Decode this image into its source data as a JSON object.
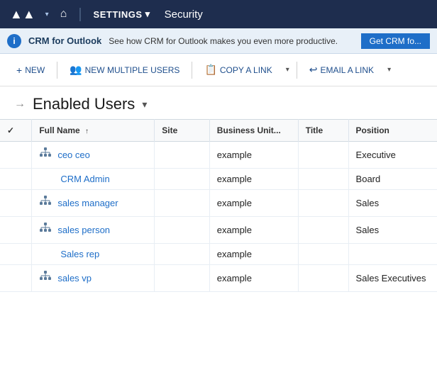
{
  "nav": {
    "logo": "▲▲",
    "home_icon": "⌂",
    "divider": "|",
    "settings_label": "SETTINGS",
    "settings_chevron": "▾",
    "security_label": "Security"
  },
  "banner": {
    "icon": "i",
    "title": "CRM for Outlook",
    "text": "See how CRM for Outlook makes you even more productive.",
    "button_label": "Get CRM fo..."
  },
  "toolbar": {
    "new_label": "NEW",
    "new_icon": "+",
    "new_multiple_label": "NEW MULTIPLE USERS",
    "new_multiple_icon": "👥",
    "copy_link_label": "COPY A LINK",
    "copy_icon": "📋",
    "copy_chevron": "▾",
    "email_link_label": "EMAIL A LINK",
    "email_icon": "↩",
    "email_chevron": "▾"
  },
  "page": {
    "header_arrow": "→",
    "title": "Enabled Users",
    "title_chevron": "▾"
  },
  "table": {
    "columns": [
      {
        "key": "check",
        "label": "✓",
        "sortable": false
      },
      {
        "key": "full_name",
        "label": "Full Name",
        "sortable": true
      },
      {
        "key": "site",
        "label": "Site",
        "sortable": false
      },
      {
        "key": "business_unit",
        "label": "Business Unit...",
        "sortable": false
      },
      {
        "key": "title",
        "label": "Title",
        "sortable": false
      },
      {
        "key": "position",
        "label": "Position",
        "sortable": false
      }
    ],
    "rows": [
      {
        "id": 1,
        "has_icon": true,
        "full_name": "ceo ceo",
        "site": "",
        "business_unit": "example",
        "title": "",
        "position": "Executive"
      },
      {
        "id": 2,
        "has_icon": false,
        "full_name": "CRM Admin",
        "site": "",
        "business_unit": "example",
        "title": "",
        "position": "Board"
      },
      {
        "id": 3,
        "has_icon": true,
        "full_name": "sales manager",
        "site": "",
        "business_unit": "example",
        "title": "",
        "position": "Sales"
      },
      {
        "id": 4,
        "has_icon": true,
        "full_name": "sales person",
        "site": "",
        "business_unit": "example",
        "title": "",
        "position": "Sales"
      },
      {
        "id": 5,
        "has_icon": false,
        "full_name": "Sales rep",
        "site": "",
        "business_unit": "example",
        "title": "",
        "position": ""
      },
      {
        "id": 6,
        "has_icon": true,
        "full_name": "sales vp",
        "site": "",
        "business_unit": "example",
        "title": "",
        "position": "Sales Executives"
      }
    ]
  }
}
